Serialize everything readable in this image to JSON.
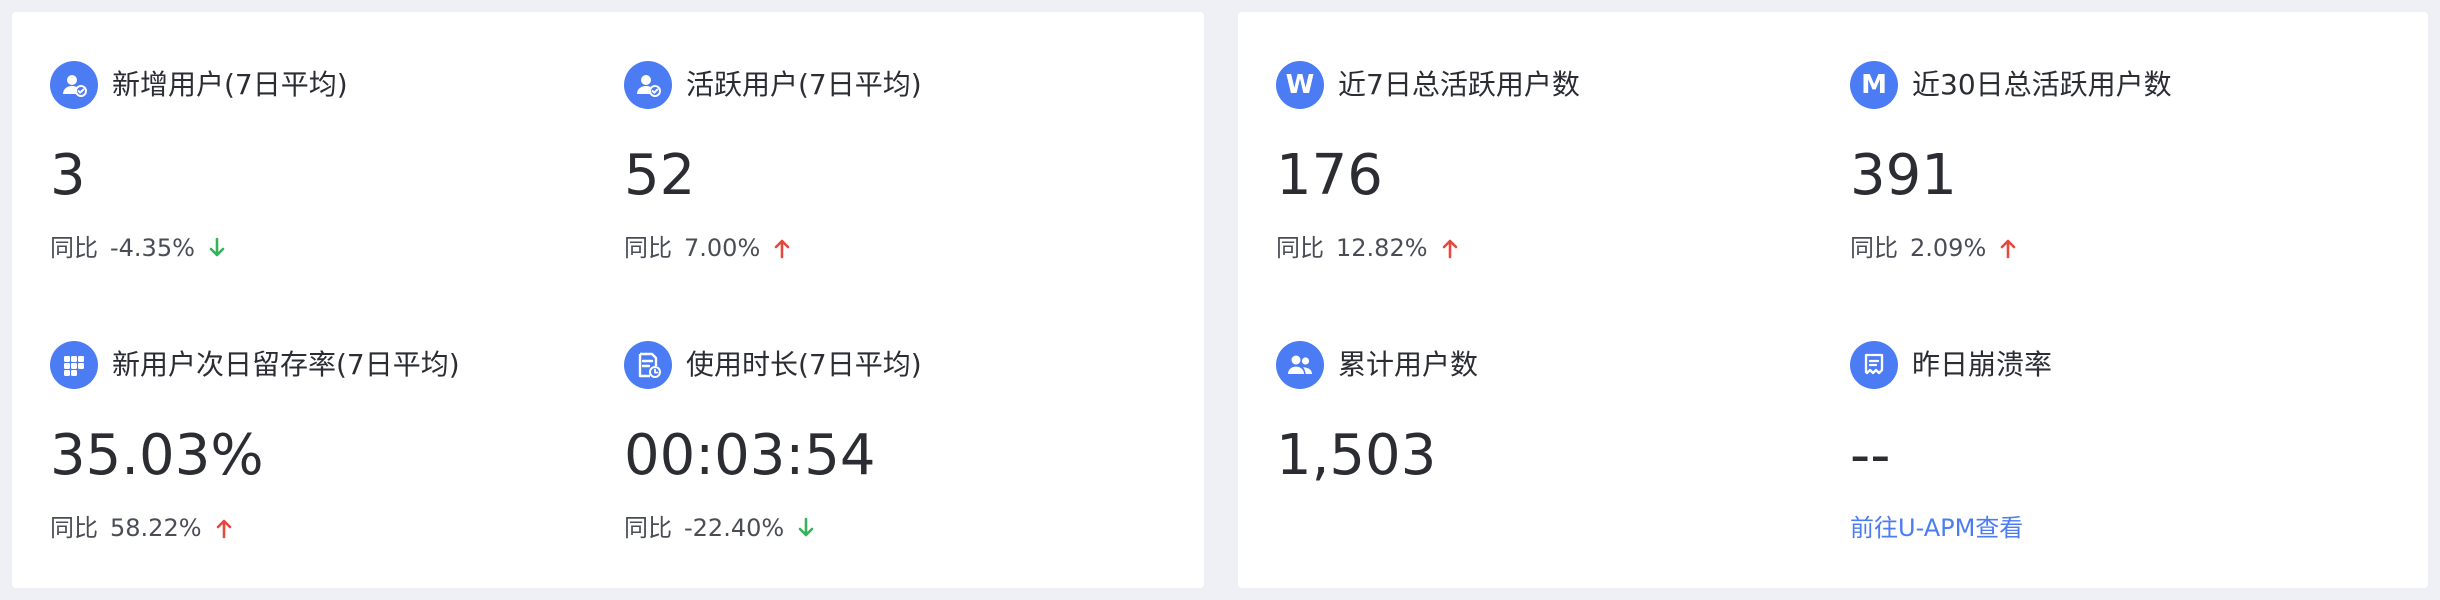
{
  "colors": {
    "accent": "#4b7cf3",
    "up": "#e5483d",
    "down": "#34b35b",
    "background": "#eef0f5",
    "panel": "#ffffff"
  },
  "left_panel": {
    "metrics": [
      {
        "title": "新增用户(7日平均)",
        "icon": "user-check-icon",
        "value": "3",
        "compare_label": "同比",
        "compare_value": "-4.35%",
        "trend": "down"
      },
      {
        "title": "活跃用户(7日平均)",
        "icon": "user-check-icon",
        "value": "52",
        "compare_label": "同比",
        "compare_value": "7.00%",
        "trend": "up"
      },
      {
        "title": "新用户次日留存率(7日平均)",
        "icon": "grid-icon",
        "value": "35.03%",
        "compare_label": "同比",
        "compare_value": "58.22%",
        "trend": "up"
      },
      {
        "title": "使用时长(7日平均)",
        "icon": "document-clock-icon",
        "value": "00:03:54",
        "compare_label": "同比",
        "compare_value": "-22.40%",
        "trend": "down"
      }
    ]
  },
  "right_panel": {
    "metrics": [
      {
        "title": "近7日总活跃用户数",
        "icon": "letter-w-icon",
        "icon_letter": "W",
        "value": "176",
        "compare_label": "同比",
        "compare_value": "12.82%",
        "trend": "up"
      },
      {
        "title": "近30日总活跃用户数",
        "icon": "letter-m-icon",
        "icon_letter": "M",
        "value": "391",
        "compare_label": "同比",
        "compare_value": "2.09%",
        "trend": "up"
      },
      {
        "title": "累计用户数",
        "icon": "users-icon",
        "value": "1,503"
      },
      {
        "title": "昨日崩溃率",
        "icon": "crash-report-icon",
        "value": "--",
        "link_label": "前往U-APM查看"
      }
    ]
  }
}
